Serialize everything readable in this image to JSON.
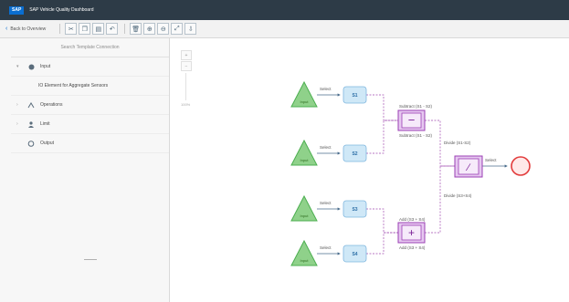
{
  "window": {
    "title": "SAP Vehicle Quality Dashboard",
    "logo": "SAP"
  },
  "toolbar": {
    "back_label": "Back to Overview",
    "icons": [
      "cut-icon",
      "copy-icon",
      "paste-icon",
      "undo-icon",
      "delete-icon",
      "zoom-in-icon",
      "zoom-out-icon",
      "zoom-fit-icon",
      "export-icon"
    ]
  },
  "left_panel": {
    "search_placeholder": "Search Template Connection",
    "tree": [
      {
        "label": "Input",
        "expanded": true
      },
      {
        "label": "IO Element for Aggregate Sensors",
        "child": true
      },
      {
        "label": "Operations"
      },
      {
        "label": "Limit"
      },
      {
        "label": "Output"
      }
    ]
  },
  "diagram": {
    "triangles": [
      {
        "label": "Input"
      },
      {
        "label": "Input"
      },
      {
        "label": "Input"
      },
      {
        "label": "Input"
      }
    ],
    "boxes": [
      {
        "label": "S1"
      },
      {
        "label": "S2"
      },
      {
        "label": "S3"
      },
      {
        "label": "S4"
      }
    ],
    "edge_labels": [
      "Select",
      "Select",
      "Select",
      "Select",
      "Select"
    ],
    "operators": [
      {
        "symbol": "−",
        "label_top": "Subtract (S1 - S2)",
        "label_bottom": "Subtract (S1 - S2)"
      },
      {
        "symbol": "+",
        "label_top": "Add (S3 + S4)",
        "label_bottom": "Add (S3 + S4)"
      },
      {
        "symbol": "∕",
        "label_top": "Divide (S1-S2)",
        "label_bottom": "Divide (S3+S4)"
      }
    ],
    "colors": {
      "triangle": "#5cb85c",
      "box": "#cfe8f7",
      "operator": "#e6c8f0",
      "end": "#e23c3c"
    }
  },
  "zoom": {
    "label": "100%"
  }
}
